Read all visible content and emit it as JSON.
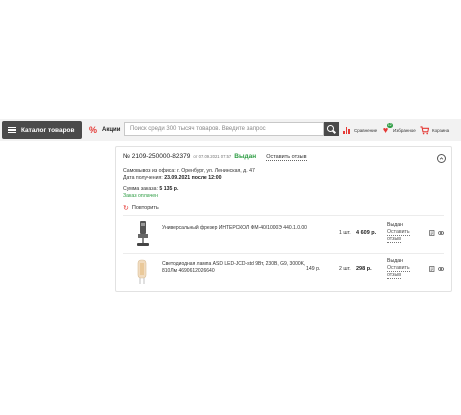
{
  "header": {
    "catalog_label": "Каталог товаров",
    "promo_label": "Акции",
    "search_placeholder": "Поиск среди 300 тысяч товаров. Введите запрос",
    "compare_label": "Сравнение",
    "favorites_label": "Избранное",
    "favorites_count": "12",
    "cart_label": "Корзина"
  },
  "order": {
    "number": "№ 2109-250000-82379",
    "date": "от 07.09.2021 07:57",
    "status": "Выдан",
    "review_link": "Оставить отзыв",
    "pickup": "Самовывоз из офиса: г. Оренбург, ул. Ленинская, д. 47",
    "received_prefix": "Дата получения:",
    "received_value": "23.09.2021 после 12:00",
    "sum_prefix": "Сумма заказа:",
    "sum_value": "5 135 р.",
    "paid": "Заказ оплачен",
    "repeat_label": "Повторить",
    "collapse_icon": "chevron-up-icon"
  },
  "items": [
    {
      "name": "Универсальный фрезер ИНТЕРСКОЛ ФМ-40/1000Э 440.1.0.00",
      "unit_price": "",
      "qty": "1 шт.",
      "price": "4 609 р.",
      "status": "Выдан",
      "review_line1": "Оставить",
      "review_line2": "отзыв"
    },
    {
      "name": "Светодиодная лампа ASD LED-JCD-std 9Вт, 230В, G9, 3000K, 810Лм 4690612026640",
      "unit_price": "149 р.",
      "qty": "2 шт.",
      "price": "298 р.",
      "status": "Выдан",
      "review_line1": "Оставить",
      "review_line2": "отзыв"
    }
  ]
}
